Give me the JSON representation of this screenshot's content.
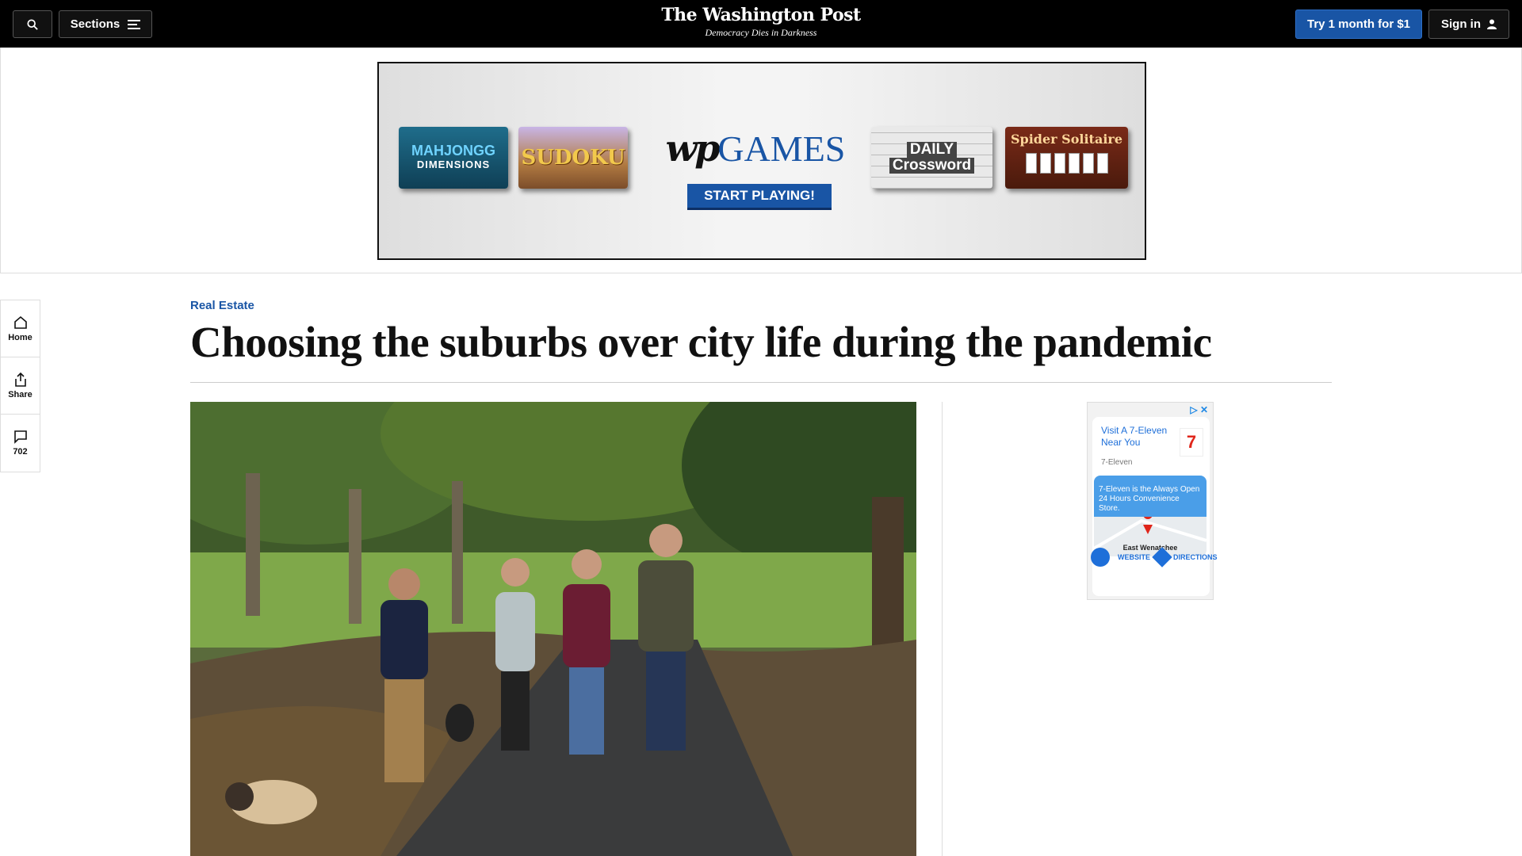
{
  "header": {
    "sections_label": "Sections",
    "logo": "The Washington Post",
    "tagline": "Democracy Dies in Darkness",
    "try_label": "Try 1 month for $1",
    "signin_label": "Sign in"
  },
  "ad_banner": {
    "mahjongg_title": "MAHJONGG",
    "mahjongg_sub": "DIMENSIONS",
    "sudoku": "SUDOKU",
    "wp_mark": "wp",
    "games": "GAMES",
    "start_label": "START PLAYING!",
    "crossword_line1": "DAILY",
    "crossword_line2": "Crossword",
    "spider": "Spider Solitaire"
  },
  "rail": {
    "home_label": "Home",
    "share_label": "Share",
    "comments_count": "702"
  },
  "article": {
    "kicker": "Real Estate",
    "headline": "Choosing the suburbs over city life during the pandemic"
  },
  "side_ad": {
    "title": "Visit A 7-Eleven Near You",
    "brand": "7-Eleven",
    "map_text": "7-Eleven is the Always Open 24 Hours Convenience Store.",
    "location": "East Wenatchee",
    "website_label": "WEBSITE",
    "directions_label": "DIRECTIONS"
  }
}
